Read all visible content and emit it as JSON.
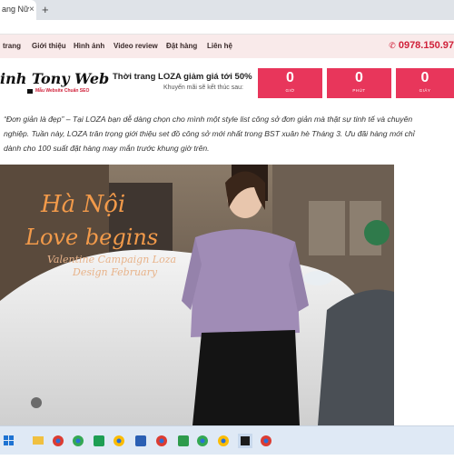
{
  "browser": {
    "tab_title": "ang Nữ",
    "tab_close": "×",
    "new_tab": "+"
  },
  "nav": {
    "items": [
      "trang",
      "Giới thiệu",
      "Hình ảnh",
      "Video review",
      "Đặt hàng",
      "Liên hệ"
    ],
    "phone": "0978.150.97",
    "phone_icon": "phone-icon"
  },
  "header": {
    "logo_text": "inh Tony Web",
    "logo_tagline": "Mẫu Website Chuẩn SEO",
    "promo_title": "Thời trang LOZA giảm giá tới 50%",
    "promo_subtitle": "Khuyến mãi sẽ kết thúc sau:",
    "countdown": [
      {
        "value": "0",
        "label": "GIỜ"
      },
      {
        "value": "0",
        "label": "PHÚT"
      },
      {
        "value": "0",
        "label": "GIÂY"
      }
    ]
  },
  "content": {
    "paragraph": "“Đơn giản là đẹp” – Tại LOZA bạn dễ dàng chọn cho mình một style list công sở đơn giản mà thật sự tinh tế và chuyên nghiệp. Tuần này, LOZA trân trọng giới thiệu set đồ công sở mới nhất trong BST xuân hè Tháng 3. Ưu đãi hàng mới chỉ dành cho 100 suất đặt hàng may mắn trước khung giờ trên."
  },
  "hero": {
    "line1": "Hà Nội",
    "line2": "Love begins",
    "line3": "Valentine Campaign Loza",
    "line4": "Design February"
  },
  "colors": {
    "accent": "#e8365b",
    "nav_bg": "#f9eaea",
    "phone": "#d0213a"
  }
}
